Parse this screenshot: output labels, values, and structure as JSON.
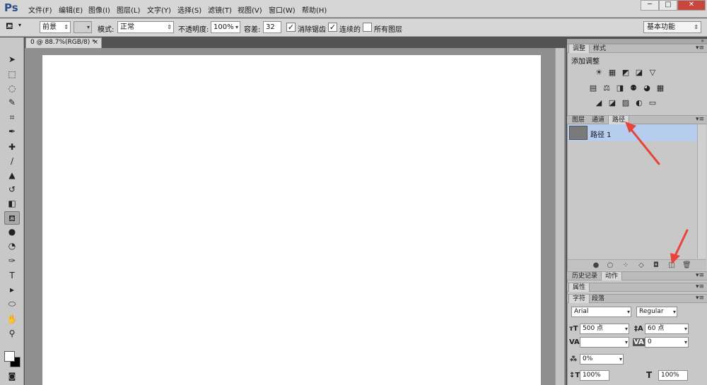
{
  "app": {
    "logo": "Ps",
    "menu": [
      "文件(F)",
      "编辑(E)",
      "图像(I)",
      "图层(L)",
      "文字(Y)",
      "选择(S)",
      "滤镜(T)",
      "视图(V)",
      "窗口(W)",
      "帮助(H)"
    ],
    "window_controls": {
      "minimize": "─",
      "maximize": "□",
      "close": "✕"
    }
  },
  "options": {
    "fill_source": "前景",
    "mode_label": "模式:",
    "mode_value": "正常",
    "opacity_label": "不透明度:",
    "opacity_value": "100%",
    "tolerance_label": "容差:",
    "tolerance_value": "32",
    "antialias_label": "消除锯齿",
    "antialias_checked": "✓",
    "contiguous_label": "连续的",
    "contiguous_checked": "✓",
    "all_layers_label": "所有图层",
    "workspace": "基本功能"
  },
  "document": {
    "tab_title": "0 @ 88.7%(RGB/8) *",
    "tab_close": "×"
  },
  "tools": [
    {
      "name": "move-tool-icon",
      "glyph": "➤"
    },
    {
      "name": "marquee-tool-icon",
      "glyph": "⬚"
    },
    {
      "name": "lasso-tool-icon",
      "glyph": "◌"
    },
    {
      "name": "quick-select-tool-icon",
      "glyph": "✎"
    },
    {
      "name": "crop-tool-icon",
      "glyph": "⌗"
    },
    {
      "name": "eyedropper-tool-icon",
      "glyph": "✒"
    },
    {
      "name": "healing-brush-tool-icon",
      "glyph": "✚"
    },
    {
      "name": "brush-tool-icon",
      "glyph": "∕"
    },
    {
      "name": "stamp-tool-icon",
      "glyph": "▲"
    },
    {
      "name": "history-brush-tool-icon",
      "glyph": "↺"
    },
    {
      "name": "eraser-tool-icon",
      "glyph": "◧"
    },
    {
      "name": "paint-bucket-tool-icon",
      "glyph": "⛾"
    },
    {
      "name": "blur-tool-icon",
      "glyph": "●"
    },
    {
      "name": "dodge-tool-icon",
      "glyph": "◔"
    },
    {
      "name": "pen-tool-icon",
      "glyph": "✑"
    },
    {
      "name": "type-tool-icon",
      "glyph": "T"
    },
    {
      "name": "path-select-tool-icon",
      "glyph": "▸"
    },
    {
      "name": "shape-tool-icon",
      "glyph": "⬭"
    },
    {
      "name": "hand-tool-icon",
      "glyph": "✋"
    },
    {
      "name": "zoom-tool-icon",
      "glyph": "⚲"
    }
  ],
  "panels": {
    "adjust_tabs": [
      "调整",
      "样式"
    ],
    "adjust_title": "添加调整",
    "layer_tabs": [
      "图层",
      "通道",
      "路径"
    ],
    "path_item": "路径 1",
    "history_tabs": [
      "历史记录",
      "动作"
    ],
    "properties_tab": "属性",
    "char_tabs": [
      "字符",
      "段落"
    ],
    "panel_menu": "▾≡"
  },
  "character": {
    "font_family": "Arial",
    "font_style": "Regular",
    "font_size": "500 点",
    "leading": "60 点",
    "kerning": "",
    "tracking": "0",
    "tsume": "0%",
    "vertical_scale": "100%",
    "horizontal_scale": "100%"
  },
  "annotation_color": "#e8443a"
}
